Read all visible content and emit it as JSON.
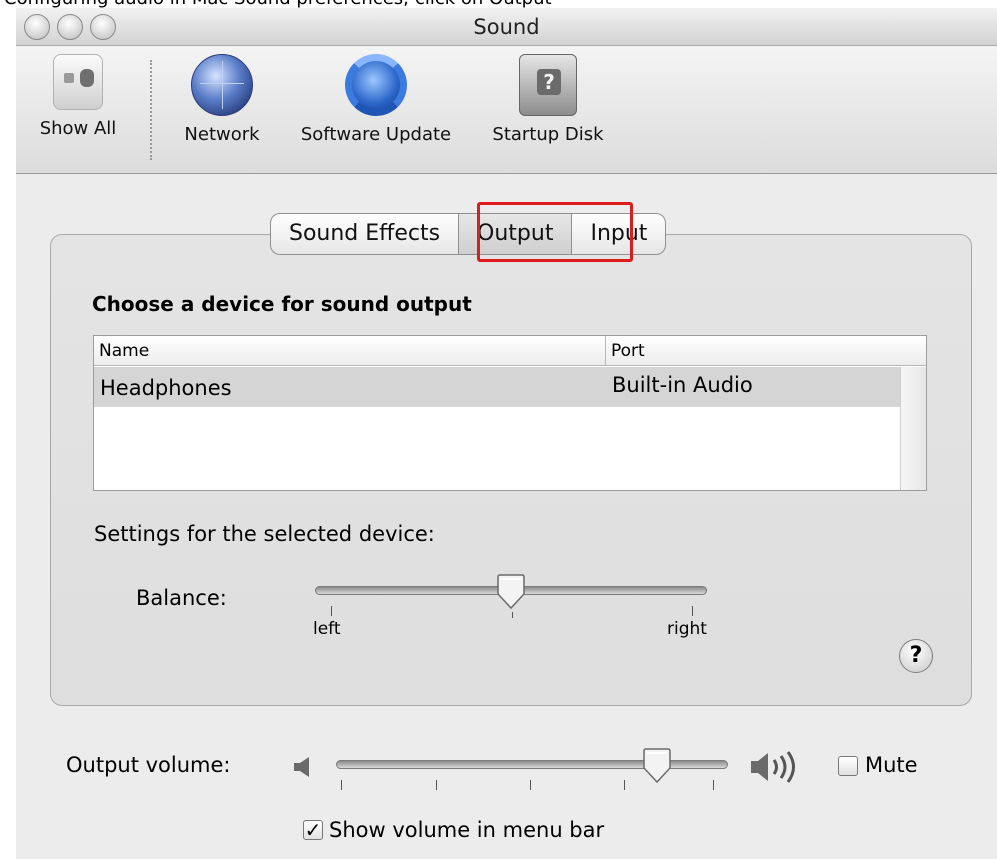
{
  "caption": "Configuring audio in Mac Sound preferences; click on Output",
  "window": {
    "title": "Sound"
  },
  "toolbar": {
    "items": [
      {
        "label": "Show All",
        "icon": "show-all-icon"
      },
      {
        "label": "Network",
        "icon": "network-globe-icon"
      },
      {
        "label": "Software Update",
        "icon": "software-update-icon"
      },
      {
        "label": "Startup Disk",
        "icon": "startup-disk-icon"
      }
    ]
  },
  "tabs": {
    "items": [
      "Sound Effects",
      "Output",
      "Input"
    ],
    "selected": "Output"
  },
  "output": {
    "section_title": "Choose a device for sound output",
    "table": {
      "columns": [
        "Name",
        "Port"
      ],
      "rows": [
        {
          "name": "Headphones",
          "port": "Built-in Audio",
          "selected": true
        }
      ]
    },
    "settings_label": "Settings for the selected device:",
    "balance": {
      "label": "Balance:",
      "left_label": "left",
      "right_label": "right",
      "value": 0.5
    },
    "help_label": "?"
  },
  "volume": {
    "label": "Output volume:",
    "value": 0.82,
    "mute_label": "Mute",
    "mute_checked": false
  },
  "menubar": {
    "label": "Show volume in menu bar",
    "checked": true,
    "check_glyph": "✓"
  },
  "colors": {
    "highlight": "#e11a1a",
    "window_bg": "#ececec",
    "selected_row": "#d5d5d5"
  }
}
